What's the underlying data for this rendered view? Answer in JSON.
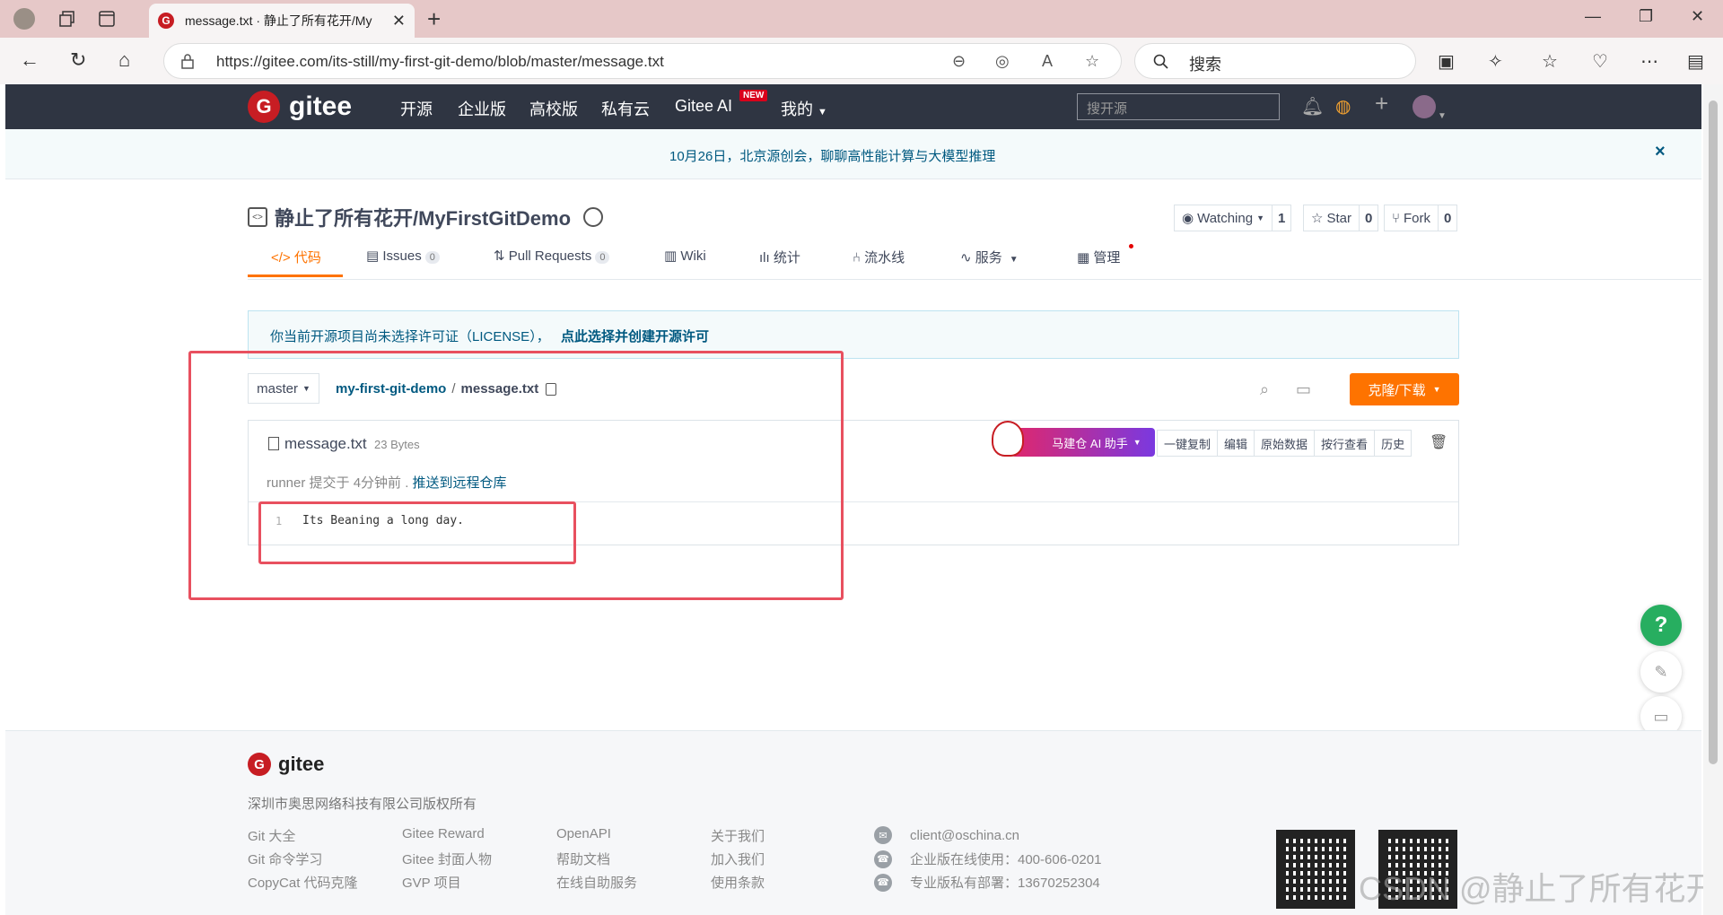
{
  "browser": {
    "tab_title": "message.txt · 静止了所有花开/My",
    "url": "https://gitee.com/its-still/my-first-git-demo/blob/master/message.txt",
    "search_placeholder": "搜索"
  },
  "site": {
    "brand": "gitee",
    "nav": [
      "开源",
      "企业版",
      "高校版",
      "私有云",
      "Gitee AI",
      "我的"
    ],
    "nav_badge": "NEW",
    "nav_search_placeholder": "搜开源",
    "banner": "10月26日，北京源创会，聊聊高性能计算与大模型推理",
    "banner_close": "×"
  },
  "repo": {
    "title": "静止了所有花开/MyFirstGitDemo",
    "watching_label": "Watching",
    "watching_count": "1",
    "star_label": "Star",
    "star_count": "0",
    "fork_label": "Fork",
    "fork_count": "0",
    "tabs": [
      {
        "label": "代码",
        "count": ""
      },
      {
        "label": "Issues",
        "count": "0"
      },
      {
        "label": "Pull Requests",
        "count": "0"
      },
      {
        "label": "Wiki",
        "count": ""
      },
      {
        "label": "统计",
        "count": ""
      },
      {
        "label": "流水线",
        "count": ""
      },
      {
        "label": "服务",
        "count": ""
      },
      {
        "label": "管理",
        "count": ""
      }
    ]
  },
  "license": {
    "notice": "你当前开源项目尚未选择许可证（LICENSE），",
    "action": "点此选择并创建开源许可"
  },
  "file": {
    "branch": "master",
    "repo_path": "my-first-git-demo",
    "path_sep": "/",
    "name": "message.txt",
    "size": "23 Bytes",
    "clone_label": "克隆/下载",
    "ai_label": "马建仓 AI 助手",
    "actions": [
      "一键复制",
      "编辑",
      "原始数据",
      "按行查看",
      "历史"
    ],
    "commit_author": "runner 提交于 4分钟前 .",
    "commit_message": "推送到远程仓库",
    "lines": [
      {
        "num": "1",
        "text": "Its Beaning a long day."
      }
    ]
  },
  "footer": {
    "brand": "gitee",
    "copyright": "深圳市奥思网络科技有限公司版权所有",
    "col1": [
      "Git 大全",
      "Git 命令学习",
      "CopyCat 代码克隆"
    ],
    "col2": [
      "Gitee Reward",
      "Gitee 封面人物",
      "GVP 项目"
    ],
    "col3": [
      "OpenAPI",
      "帮助文档",
      "在线自助服务"
    ],
    "col4": [
      "关于我们",
      "加入我们",
      "使用条款"
    ],
    "contacts": [
      "client@oschina.cn",
      "企业版在线使用：400-606-0201",
      "专业版私有部署：13670252304"
    ],
    "watermark": "CSDN @静止了所有花开"
  },
  "floating": {
    "help": "?"
  }
}
